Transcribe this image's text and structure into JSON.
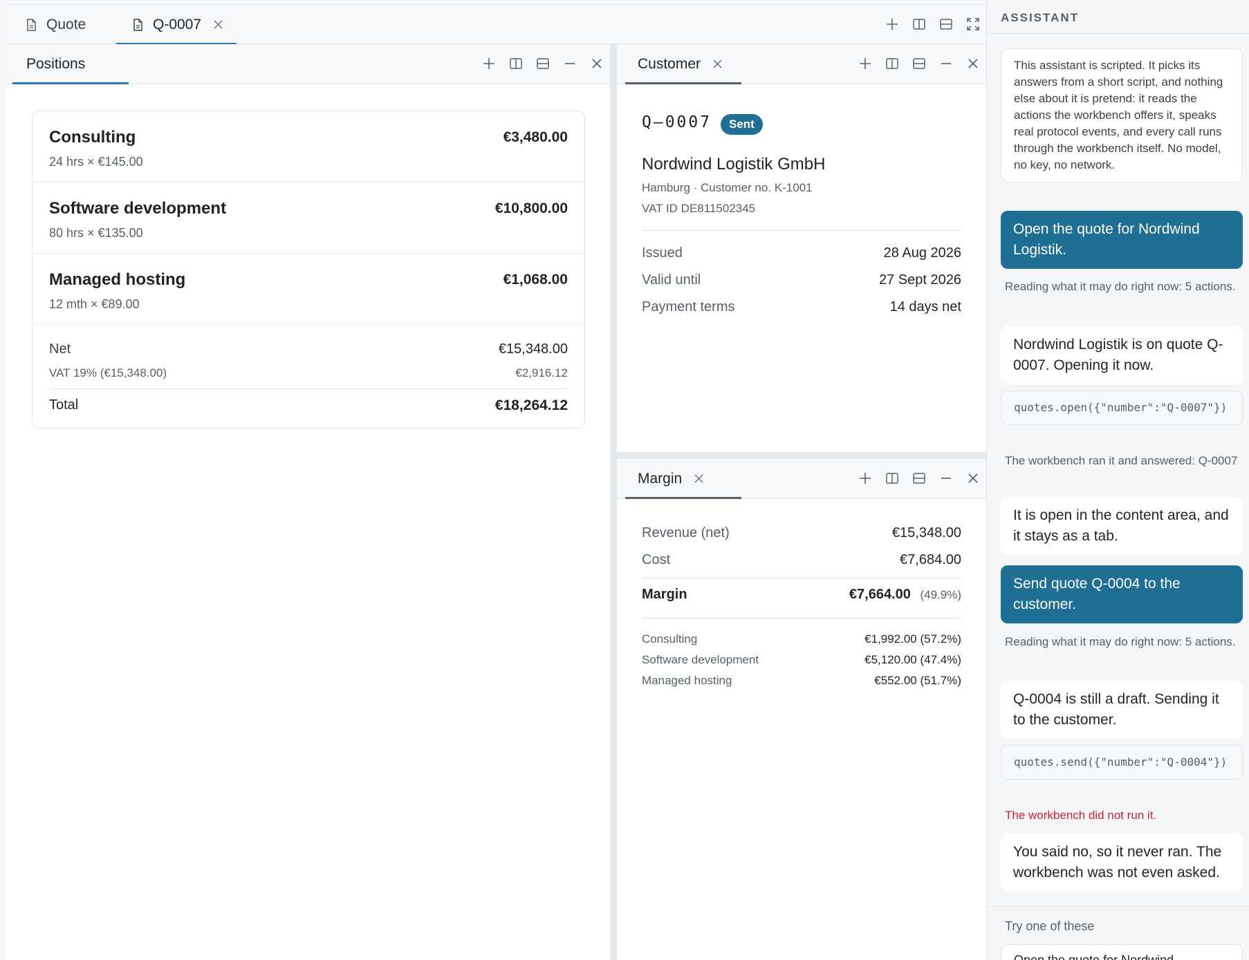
{
  "top_tabs": [
    {
      "label": "Quote",
      "icon": "document-icon"
    },
    {
      "label": "Q-0007",
      "icon": "document-icon",
      "active": true
    }
  ],
  "positions": {
    "tab_label": "Positions",
    "items": [
      {
        "name": "Consulting",
        "detail": "24 hrs × €145.00",
        "amount": "€3,480.00"
      },
      {
        "name": "Software development",
        "detail": "80 hrs × €135.00",
        "amount": "€10,800.00"
      },
      {
        "name": "Managed hosting",
        "detail": "12 mth × €89.00",
        "amount": "€1,068.00"
      }
    ],
    "net_label": "Net",
    "net_value": "€15,348.00",
    "vat_label": "VAT 19% (€15,348.00)",
    "vat_value": "€2,916.12",
    "total_label": "Total",
    "total_value": "€18,264.12"
  },
  "customer": {
    "tab_label": "Customer",
    "quote_number": "Q–0007",
    "status": "Sent",
    "name": "Nordwind Logistik GmbH",
    "location_line": "Hamburg · Customer no. K-1001",
    "vat_line": "VAT ID DE811502345",
    "fields": [
      {
        "label": "Issued",
        "value": "28 Aug 2026"
      },
      {
        "label": "Valid until",
        "value": "27 Sept 2026"
      },
      {
        "label": "Payment terms",
        "value": "14 days net"
      }
    ]
  },
  "margin": {
    "tab_label": "Margin",
    "revenue_label": "Revenue (net)",
    "revenue_value": "€15,348.00",
    "cost_label": "Cost",
    "cost_value": "€7,684.00",
    "margin_label": "Margin",
    "margin_value": "€7,664.00",
    "margin_pct": "(49.9%)",
    "breakdown": [
      {
        "label": "Consulting",
        "value": "€1,992.00 (57.2%)"
      },
      {
        "label": "Software development",
        "value": "€5,120.00 (47.4%)"
      },
      {
        "label": "Managed hosting",
        "value": "€552.00 (51.7%)"
      }
    ]
  },
  "assistant": {
    "title": "ASSISTANT",
    "intro": "This assistant is scripted. It picks its answers from a short script, and nothing else about it is pretend: it reads the actions the workbench offers it, speaks real protocol events, and every call runs through the workbench itself. No model, no key, no network.",
    "user_msg_1": "Open the quote for Nordwind Logistik.",
    "note_1": "Reading what it may do right now: 5 actions.",
    "reply_1": "Nordwind Logistik is on quote Q-0007. Opening it now.",
    "code_1": "quotes.open({\"number\":\"Q-0007\"})",
    "note_2": "The workbench ran it and answered: Q-0007",
    "reply_2": "It is open in the content area, and it stays as a tab.",
    "user_msg_2": "Send quote Q-0004 to the customer.",
    "note_3": "Reading what it may do right now: 5 actions.",
    "reply_3": "Q-0004 is still a draft. Sending it to the customer.",
    "code_2": "quotes.send({\"number\":\"Q-0004\"})",
    "error_note": "The workbench did not run it.",
    "reply_4": "You said no, so it never ran. The workbench was not even asked.",
    "suggest_title": "Try one of these",
    "suggestion_1": "Open the quote for Nordwind..."
  },
  "colors": {
    "accent": "#2b79b7",
    "user_bubble": "#1f6f95",
    "error": "#cf222e"
  }
}
